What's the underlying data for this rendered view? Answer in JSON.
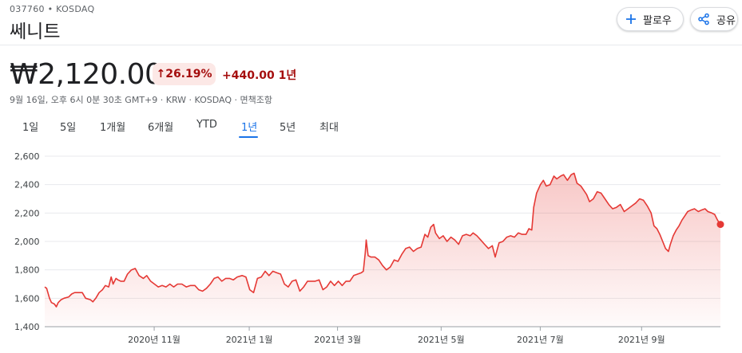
{
  "header": {
    "ticker": "037760 • KOSDAQ",
    "company_name": "쎄니트",
    "follow_label": "팔로우",
    "share_label": "공유"
  },
  "quote": {
    "price": "₩2,120.00",
    "percent_change": "↑26.19%",
    "abs_change": "+440.00 1년",
    "meta": "9월 16일, 오후 6시 0분 30초 GMT+9 · KRW · KOSDAQ · 면책조항"
  },
  "range_tabs": [
    "1일",
    "5일",
    "1개월",
    "6개월",
    "YTD",
    "1년",
    "5년",
    "최대"
  ],
  "active_tab": "1년",
  "colors": {
    "accent": "#1a73e8",
    "down_bg": "#fce8e6",
    "line": "#e53935"
  },
  "icons": {
    "follow": "plus-icon",
    "share": "share-icon"
  },
  "chart_data": {
    "type": "area",
    "title": "",
    "xlabel": "",
    "ylabel": "",
    "ylim": [
      1400,
      2600
    ],
    "yticks": [
      1400,
      1600,
      1800,
      2000,
      2200,
      2400,
      2600
    ],
    "y_tick_labels": [
      "1,400",
      "1,600",
      "1,800",
      "2,000",
      "2,200",
      "2,400",
      "2,600"
    ],
    "x_tick_labels": [
      "2020년 11월",
      "2021년 1월",
      "2021년 3월",
      "2021년 5월",
      "2021년 7월",
      "2021년 9월"
    ],
    "x_ticks": [
      0.243,
      0.454,
      0.65,
      0.88,
      1.1,
      1.325
    ],
    "grid": true,
    "series": [
      {
        "values": [
          [
            0.0,
            1680
          ],
          [
            0.004,
            1670
          ],
          [
            0.01,
            1600
          ],
          [
            0.014,
            1570
          ],
          [
            0.02,
            1560
          ],
          [
            0.024,
            1540
          ],
          [
            0.028,
            1570
          ],
          [
            0.034,
            1590
          ],
          [
            0.04,
            1600
          ],
          [
            0.05,
            1610
          ],
          [
            0.056,
            1630
          ],
          [
            0.062,
            1640
          ],
          [
            0.07,
            1640
          ],
          [
            0.078,
            1640
          ],
          [
            0.085,
            1600
          ],
          [
            0.095,
            1590
          ],
          [
            0.1,
            1575
          ],
          [
            0.106,
            1600
          ],
          [
            0.113,
            1640
          ],
          [
            0.12,
            1660
          ],
          [
            0.126,
            1690
          ],
          [
            0.133,
            1680
          ],
          [
            0.138,
            1750
          ],
          [
            0.142,
            1700
          ],
          [
            0.148,
            1740
          ],
          [
            0.152,
            1730
          ],
          [
            0.158,
            1720
          ],
          [
            0.165,
            1720
          ],
          [
            0.172,
            1770
          ],
          [
            0.18,
            1800
          ],
          [
            0.188,
            1810
          ],
          [
            0.196,
            1760
          ],
          [
            0.205,
            1740
          ],
          [
            0.212,
            1760
          ],
          [
            0.22,
            1720
          ],
          [
            0.228,
            1700
          ],
          [
            0.236,
            1680
          ],
          [
            0.244,
            1690
          ],
          [
            0.252,
            1680
          ],
          [
            0.26,
            1700
          ],
          [
            0.268,
            1680
          ],
          [
            0.276,
            1700
          ],
          [
            0.285,
            1700
          ],
          [
            0.294,
            1680
          ],
          [
            0.303,
            1690
          ],
          [
            0.312,
            1690
          ],
          [
            0.32,
            1660
          ],
          [
            0.328,
            1650
          ],
          [
            0.336,
            1670
          ],
          [
            0.344,
            1700
          ],
          [
            0.352,
            1740
          ],
          [
            0.36,
            1750
          ],
          [
            0.368,
            1720
          ],
          [
            0.376,
            1740
          ],
          [
            0.384,
            1740
          ],
          [
            0.392,
            1730
          ],
          [
            0.4,
            1750
          ],
          [
            0.41,
            1760
          ],
          [
            0.418,
            1750
          ],
          [
            0.426,
            1660
          ],
          [
            0.434,
            1640
          ],
          [
            0.442,
            1740
          ],
          [
            0.45,
            1750
          ],
          [
            0.458,
            1790
          ],
          [
            0.466,
            1760
          ],
          [
            0.474,
            1790
          ],
          [
            0.482,
            1780
          ],
          [
            0.49,
            1770
          ],
          [
            0.498,
            1700
          ],
          [
            0.506,
            1680
          ],
          [
            0.514,
            1720
          ],
          [
            0.522,
            1730
          ],
          [
            0.53,
            1650
          ],
          [
            0.538,
            1680
          ],
          [
            0.546,
            1720
          ],
          [
            0.554,
            1720
          ],
          [
            0.562,
            1720
          ],
          [
            0.57,
            1730
          ],
          [
            0.578,
            1660
          ],
          [
            0.586,
            1680
          ],
          [
            0.594,
            1720
          ],
          [
            0.602,
            1690
          ],
          [
            0.61,
            1720
          ],
          [
            0.618,
            1690
          ],
          [
            0.626,
            1720
          ],
          [
            0.634,
            1720
          ],
          [
            0.642,
            1760
          ],
          [
            0.65,
            1770
          ],
          [
            0.658,
            1780
          ],
          [
            0.662,
            1790
          ],
          [
            0.666,
            1920
          ],
          [
            0.668,
            2010
          ],
          [
            0.672,
            1900
          ],
          [
            0.678,
            1890
          ],
          [
            0.686,
            1890
          ],
          [
            0.694,
            1870
          ],
          [
            0.702,
            1830
          ],
          [
            0.71,
            1800
          ],
          [
            0.718,
            1820
          ],
          [
            0.726,
            1870
          ],
          [
            0.734,
            1860
          ],
          [
            0.742,
            1910
          ],
          [
            0.75,
            1950
          ],
          [
            0.758,
            1960
          ],
          [
            0.766,
            1930
          ],
          [
            0.774,
            1950
          ],
          [
            0.782,
            1960
          ],
          [
            0.79,
            2050
          ],
          [
            0.796,
            2030
          ],
          [
            0.802,
            2100
          ],
          [
            0.808,
            2120
          ],
          [
            0.812,
            2060
          ],
          [
            0.82,
            2020
          ],
          [
            0.828,
            2040
          ],
          [
            0.836,
            2000
          ],
          [
            0.844,
            2030
          ],
          [
            0.852,
            2010
          ],
          [
            0.86,
            1980
          ],
          [
            0.868,
            2040
          ],
          [
            0.876,
            2050
          ],
          [
            0.884,
            2040
          ],
          [
            0.89,
            2060
          ],
          [
            0.898,
            2040
          ],
          [
            0.906,
            2010
          ],
          [
            0.914,
            1980
          ],
          [
            0.922,
            1950
          ],
          [
            0.93,
            1970
          ],
          [
            0.936,
            1890
          ],
          [
            0.944,
            1990
          ],
          [
            0.952,
            2000
          ],
          [
            0.96,
            2030
          ],
          [
            0.968,
            2040
          ],
          [
            0.976,
            2030
          ],
          [
            0.984,
            2060
          ],
          [
            0.992,
            2050
          ],
          [
            1.0,
            2050
          ],
          [
            1.006,
            2090
          ],
          [
            1.012,
            2080
          ],
          [
            1.016,
            2240
          ],
          [
            1.022,
            2340
          ],
          [
            1.03,
            2400
          ],
          [
            1.036,
            2430
          ],
          [
            1.042,
            2390
          ],
          [
            1.05,
            2400
          ],
          [
            1.058,
            2460
          ],
          [
            1.064,
            2440
          ],
          [
            1.072,
            2460
          ],
          [
            1.078,
            2470
          ],
          [
            1.086,
            2430
          ],
          [
            1.094,
            2470
          ],
          [
            1.1,
            2480
          ],
          [
            1.106,
            2410
          ],
          [
            1.114,
            2390
          ],
          [
            1.12,
            2360
          ],
          [
            1.126,
            2330
          ],
          [
            1.132,
            2280
          ],
          [
            1.14,
            2300
          ],
          [
            1.148,
            2350
          ],
          [
            1.156,
            2340
          ],
          [
            1.164,
            2300
          ],
          [
            1.172,
            2260
          ],
          [
            1.18,
            2230
          ],
          [
            1.188,
            2240
          ],
          [
            1.196,
            2260
          ],
          [
            1.204,
            2210
          ],
          [
            1.212,
            2230
          ],
          [
            1.22,
            2250
          ],
          [
            1.228,
            2270
          ],
          [
            1.236,
            2300
          ],
          [
            1.244,
            2290
          ],
          [
            1.252,
            2250
          ],
          [
            1.26,
            2200
          ],
          [
            1.266,
            2110
          ],
          [
            1.272,
            2090
          ],
          [
            1.278,
            2050
          ],
          [
            1.284,
            2000
          ],
          [
            1.29,
            1950
          ],
          [
            1.296,
            1930
          ],
          [
            1.3,
            1980
          ],
          [
            1.306,
            2040
          ],
          [
            1.312,
            2080
          ],
          [
            1.318,
            2110
          ],
          [
            1.324,
            2150
          ],
          [
            1.33,
            2180
          ],
          [
            1.336,
            2210
          ],
          [
            1.342,
            2220
          ],
          [
            1.35,
            2230
          ],
          [
            1.358,
            2210
          ],
          [
            1.364,
            2220
          ],
          [
            1.372,
            2230
          ],
          [
            1.378,
            2210
          ],
          [
            1.386,
            2200
          ],
          [
            1.392,
            2190
          ],
          [
            1.398,
            2150
          ],
          [
            1.404,
            2120
          ]
        ]
      }
    ]
  }
}
